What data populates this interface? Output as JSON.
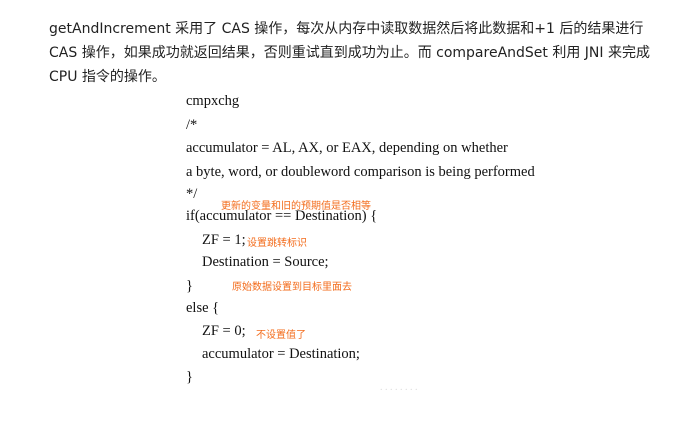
{
  "intro": {
    "line1": "getAndIncrement 采用了 CAS 操作，每次从内存中读取数据然后将此数据和+1 后的结果进行",
    "line2": "CAS 操作，如果成功就返回结果，否则重试直到成功为止。而 compareAndSet 利用 JNI 来完成",
    "line3": "CPU 指令的操作。"
  },
  "code": {
    "l1": "cmpxchg",
    "l2": "/*",
    "l3": "accumulator = AL, AX, or EAX, depending on whether",
    "l4": "a byte, word, or doubleword comparison is being performed",
    "l5": "*/",
    "l6": "if(accumulator == Destination) {",
    "l7": "ZF = 1;",
    "l8": "Destination = Source;",
    "l9": "}",
    "l10": "else {",
    "l11": "ZF = 0;",
    "l12": "accumulator = Destination;",
    "l13": "}"
  },
  "annotations": {
    "compare_note": "更新的变量和旧的预期值是否相等",
    "set_flag_note": "设置跳转标识",
    "assign_note": "原始数据设置到目标里面去",
    "no_flag_note": "不设置值了",
    "color": "#f36c1c"
  }
}
